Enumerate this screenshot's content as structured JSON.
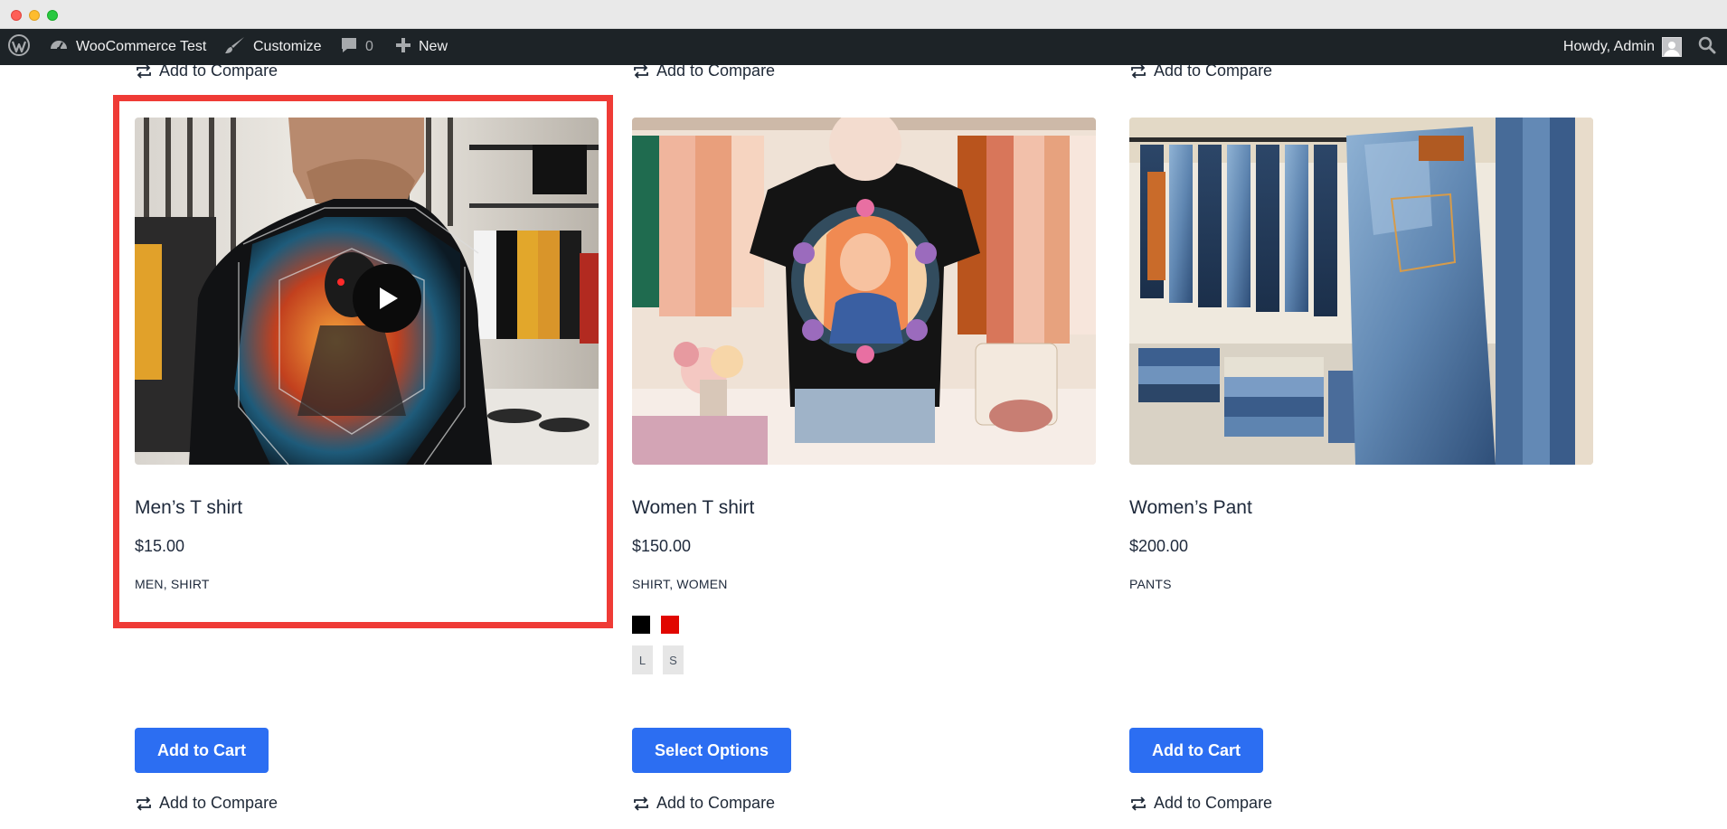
{
  "window": {
    "controls": [
      "close",
      "minimize",
      "zoom"
    ]
  },
  "adminbar": {
    "wp_icon": "wordpress-logo-icon",
    "site_name": "WooCommerce Test",
    "customize_label": "Customize",
    "comments_count": "0",
    "new_label": "New",
    "howdy_label": "Howdy, Admin"
  },
  "compare_label": "Add to Compare",
  "products": [
    {
      "title": "Men’s T shirt",
      "price": "$15.00",
      "categories": "MEN, SHIRT",
      "button_label": "Add to Cart",
      "image": "man wearing black graphic t-shirt in store",
      "has_video": true,
      "highlighted": true
    },
    {
      "title": "Women T shirt",
      "price": "$150.00",
      "categories": "SHIRT, WOMEN",
      "button_label": "Select Options",
      "image": "black women t-shirt on mannequin",
      "swatches": [
        "#000000",
        "#e10600"
      ],
      "sizes": [
        "L",
        "S"
      ]
    },
    {
      "title": "Women’s Pant",
      "price": "$200.00",
      "categories": "PANTS",
      "button_label": "Add to Cart",
      "image": "blue jeans on store racks"
    }
  ],
  "colors": {
    "accent": "#2c6ef2",
    "highlight": "#ef3b36",
    "adminbar_bg": "#1d2327"
  }
}
